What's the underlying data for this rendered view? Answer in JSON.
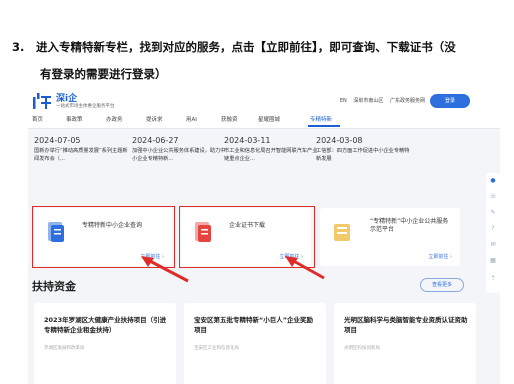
{
  "step": {
    "number": "3.",
    "line1": "进入专精特新专栏，找到对应的服务，点击【立即前往】，即可查询、下载证书（没",
    "line2": "有登录的需要进行登录）"
  },
  "site": {
    "brand": "深i企",
    "brand_sub": "一站式市场主体惠企服务平台",
    "lang": "EN",
    "region": "深圳市南山区",
    "portal": "广东政务服务网",
    "login": "登录"
  },
  "nav": [
    "首页",
    "事政策",
    "办政务",
    "提诉求",
    "用AI",
    "获融资",
    "星耀圈城",
    "专精特新"
  ],
  "news": [
    {
      "date": "2024-07-05",
      "title": "国新办举行“推动高质量发展”系列主题新闻发布会（..."
    },
    {
      "date": "2024-06-27",
      "title": "加强中小企业公共服务体系建设，助力中小企业专精特新..."
    },
    {
      "date": "2024-03-11",
      "title": "工信部：四方面工作促进中小企业专精特新发展"
    },
    {
      "date": "2024-03-08",
      "title": "市工业和信息化局召开智能网联汽车产业链重点企业..."
    }
  ],
  "cards": [
    {
      "title": "专精特新中小企业查询",
      "go": "立即前往 ›"
    },
    {
      "title": "企业证书下载",
      "go": "立即前往 ›"
    },
    {
      "title": "“专精特新”中小企业公共服务示范平台",
      "go": "立即前往 ›"
    }
  ],
  "section": {
    "title": "扶持资金",
    "more": "查看更多"
  },
  "funds": [
    {
      "title": "2023年罗湖区大健康产业扶持项目（引进专精特新企业租金扶持）",
      "meta": "罗湖区发展和改革局"
    },
    {
      "title": "宝安区第五批专精特新“小巨人”企业奖励项目",
      "meta": "宝安区工业和信息化局"
    },
    {
      "title": "光明区脑科学与类脑智能专业资质认证资助项目",
      "meta": "光明区科技创新局"
    }
  ],
  "colors": {
    "brand": "#1a5fd0",
    "accent": "#2e6fde",
    "highlight": "#e02b2b"
  }
}
